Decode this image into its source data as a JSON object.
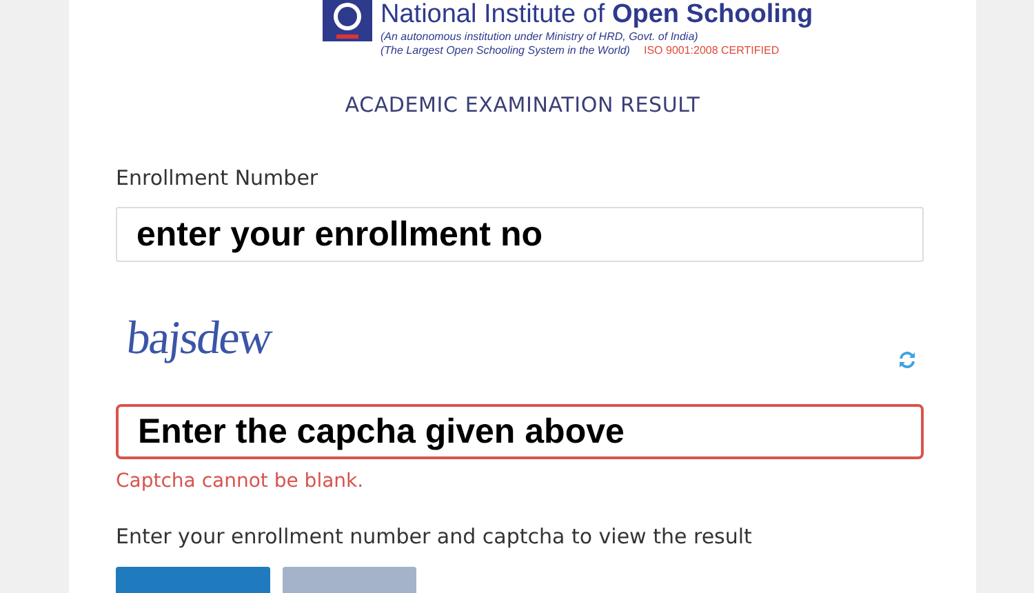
{
  "header": {
    "name": "National Institute of **Open Schooling**",
    "subtitle": "(An autonomous institution under  Ministry of HRD, Govt. of India)",
    "tagline": "(The Largest Open Schooling System in the World)",
    "certification": "ISO 9001:2008 CERTIFIED"
  },
  "title": "ACADEMIC EXAMINATION RESULT",
  "enrollment": {
    "label": "Enrollment Number",
    "value": "enter your enrollment no",
    "invalid": false
  },
  "captcha": {
    "code": "bajsdew"
  },
  "captcha_input": {
    "value": "Enter the capcha given above",
    "invalid": true,
    "error": "Captcha cannot be blank."
  },
  "help": "Enter your enrollment number and captcha to view the result",
  "buttons": [
    {
      "kind": "primary"
    },
    {
      "kind": "secondary"
    }
  ]
}
